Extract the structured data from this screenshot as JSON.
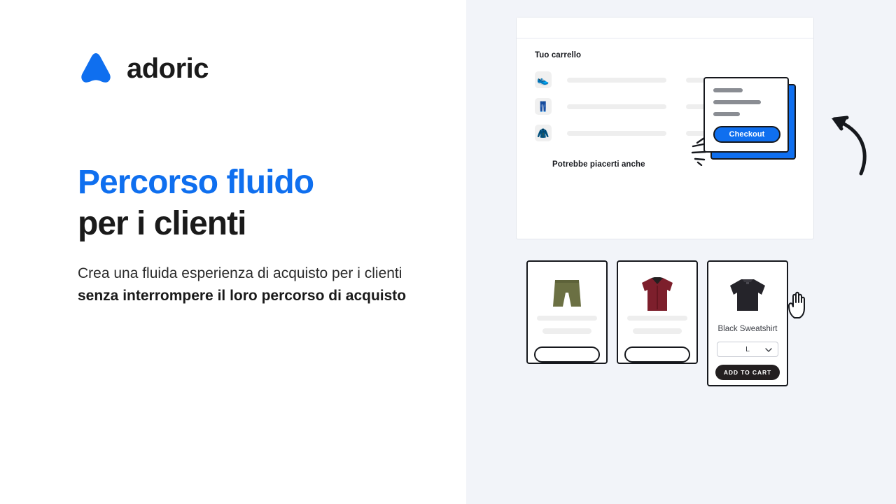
{
  "brand": {
    "logo_icon": "adoric-triangle-logo-icon",
    "name": "adoric",
    "accent_color": "#0f6fef"
  },
  "hero": {
    "headline_line1": "Percorso fluido",
    "headline_line2": "per i clienti",
    "subcopy_normal_1": "Crea una fluida esperienza di acquisto per i clienti ",
    "subcopy_bold": "senza interrompere il loro percorso di acquisto"
  },
  "illustration": {
    "cart": {
      "label": "Tuo carrello",
      "items": [
        {
          "icon": "running-shoe-icon",
          "glyph": "👟"
        },
        {
          "icon": "trousers-icon",
          "glyph": "👖"
        },
        {
          "icon": "coat-icon",
          "glyph": "🧥"
        }
      ]
    },
    "popup": {
      "checkout_label": "Checkout",
      "shadow_color": "#0f6fef",
      "sparkle_icon": "sparkle-burst-icon"
    },
    "recommendations": {
      "label": "Potrebbe piacerti anche",
      "cards": [
        {
          "product_icon": "olive-shorts-icon",
          "name": "",
          "button": ""
        },
        {
          "product_icon": "maroon-shirt-icon",
          "name": "",
          "button": ""
        },
        {
          "product_icon": "black-sweatshirt-icon",
          "name": "Black Sweatshirt",
          "size_value": "L",
          "button": "ADD TO CART"
        }
      ]
    },
    "cursor_icon": "pointing-hand-cursor-icon",
    "arrow_icon": "curved-arrow-left-icon"
  }
}
